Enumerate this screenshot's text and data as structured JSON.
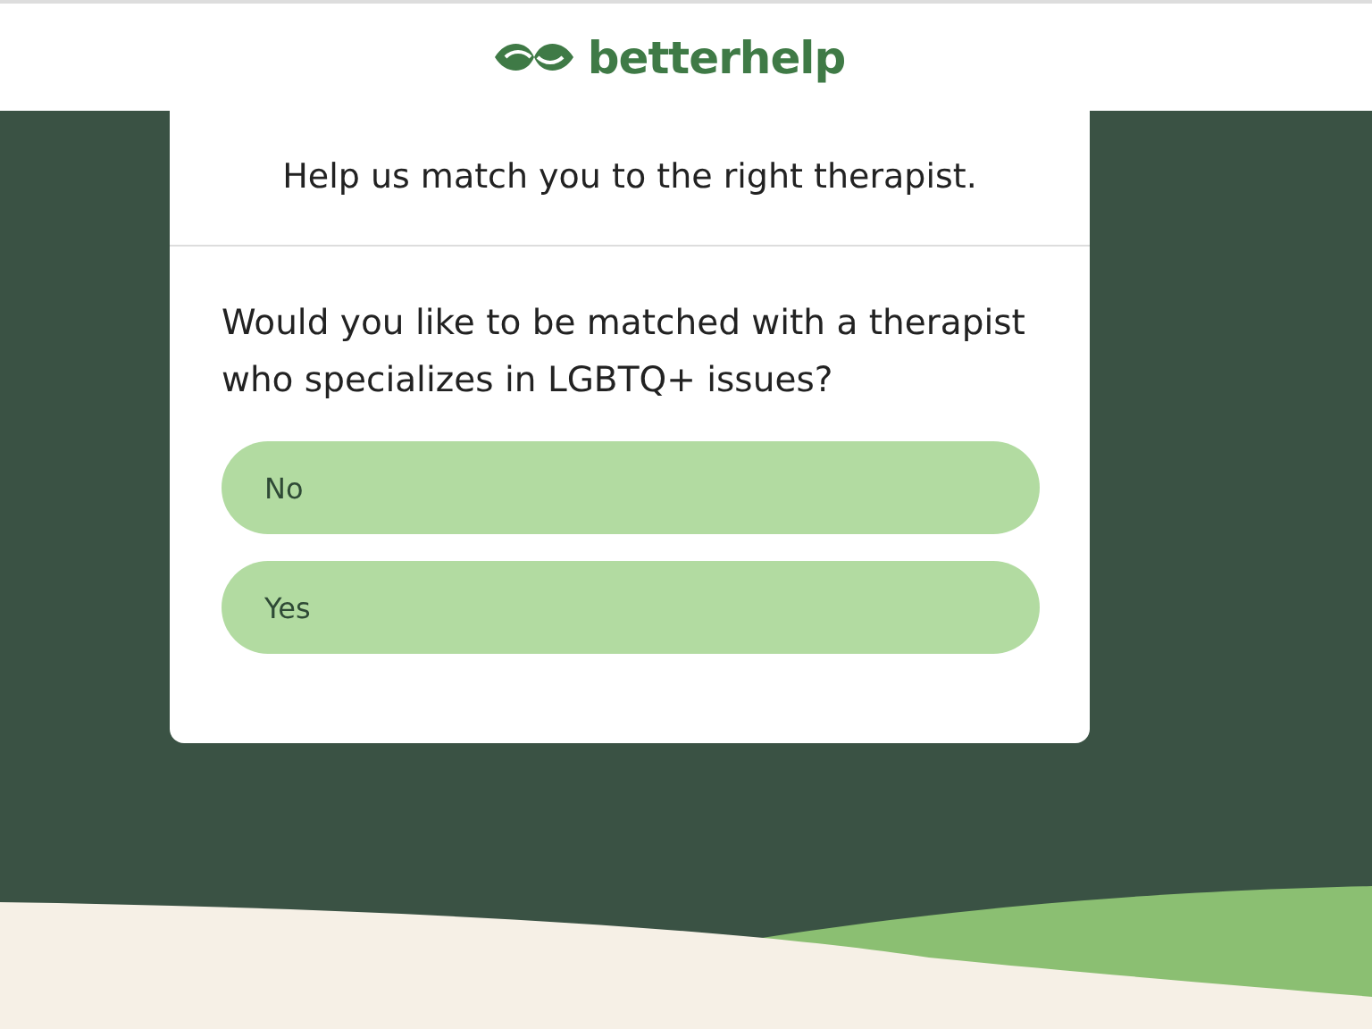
{
  "header": {
    "logo_text": "betterhelp"
  },
  "card": {
    "title": "Help us match you to the right therapist.",
    "question": "Would you like to be matched with a therapist who specializes in LGBTQ+ issues?",
    "options": [
      {
        "label": "No"
      },
      {
        "label": "Yes"
      }
    ]
  }
}
